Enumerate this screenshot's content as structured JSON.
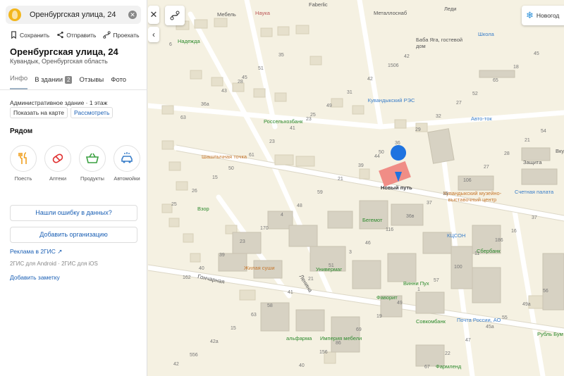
{
  "search": {
    "query": "Оренбургская улица, 24"
  },
  "actions": [
    {
      "label": "Сохранить",
      "icon": "bookmark-icon"
    },
    {
      "label": "Отправить",
      "icon": "share-icon"
    },
    {
      "label": "Проехать",
      "icon": "directions-icon"
    }
  ],
  "place": {
    "title": "Оренбургская улица, 24",
    "subtitle": "Кувандык, Оренбургская область",
    "building": "Административное здание · 1 этаж",
    "show_on_map": "Показать на карте",
    "measure": "Рассмотреть"
  },
  "tabs": [
    {
      "label": "Инфо",
      "active": true
    },
    {
      "label": "В здании",
      "badge": "2"
    },
    {
      "label": "Отзывы"
    },
    {
      "label": "Фото"
    }
  ],
  "nearby": {
    "title": "Рядом",
    "categories": [
      {
        "label": "Поесть",
        "icon": "fork-knife-icon",
        "color": "#f0a020"
      },
      {
        "label": "Аптеки",
        "icon": "pharmacy-icon",
        "color": "#e03030"
      },
      {
        "label": "Продукты",
        "icon": "basket-icon",
        "color": "#3aa040"
      },
      {
        "label": "Автомойки",
        "icon": "car-wash-icon",
        "color": "#3a7ec9"
      }
    ]
  },
  "buttons": {
    "report_error": "Нашли ошибку в данных?",
    "add_org": "Добавить организацию"
  },
  "ad_link": "Реклама в 2ГИС ↗",
  "apps_text": "2ГИС для Android · 2ГИС для iOS",
  "add_note": "Добавить заметку",
  "map": {
    "weather": "Новогод",
    "marker_label": "Новый путь",
    "labels": [
      "Мебель",
      "Наука",
      "Faberlic",
      "Металлоснаб",
      "Леди",
      "Школа",
      "Надежда",
      "Баба Яга, гостевой дом",
      "Кувандыкский РЭС",
      "Авто-ток",
      "Россельхозбанк",
      "Шашлычная точка",
      "Защита",
      "Вкус",
      "Кувандыкский музейно-выставочный центр",
      "Счетная палата",
      "Бегемот",
      "КЦСОН",
      "Сбербанк",
      "Взор",
      "Жилая суши",
      "Универмаг",
      "Винни Пух",
      "Фаворит",
      "Совкомбанк",
      "Почта России, АО",
      "Рубль Бум",
      "альфарма",
      "Империя мебели",
      "Фармленд",
      "Гончарная",
      "Ленина"
    ],
    "numbers": [
      "6",
      "28",
      "23",
      "44",
      "18",
      "16",
      "40",
      "58",
      "86",
      "42",
      "52",
      "54",
      "50",
      "48",
      "46",
      "57",
      "55",
      "556",
      "51",
      "49",
      "36",
      "106",
      "37",
      "39",
      "41",
      "69",
      "67",
      "65",
      "63",
      "61",
      "59",
      "116",
      "100",
      "49a",
      "42a",
      "35",
      "31",
      "29",
      "27",
      "25",
      "23",
      "21",
      "19",
      "22",
      "18",
      "36a",
      "23",
      "21",
      "36в",
      "11",
      "56",
      "15",
      "40",
      "42",
      "32",
      "28",
      "26",
      "170",
      "51",
      "49",
      "47",
      "45",
      "43",
      "41",
      "39",
      "37",
      "186",
      "162",
      "63",
      "156",
      "1506",
      "27",
      "21",
      "15",
      "4",
      "3",
      "1",
      "45a",
      "42",
      "45",
      "25",
      "50"
    ]
  }
}
